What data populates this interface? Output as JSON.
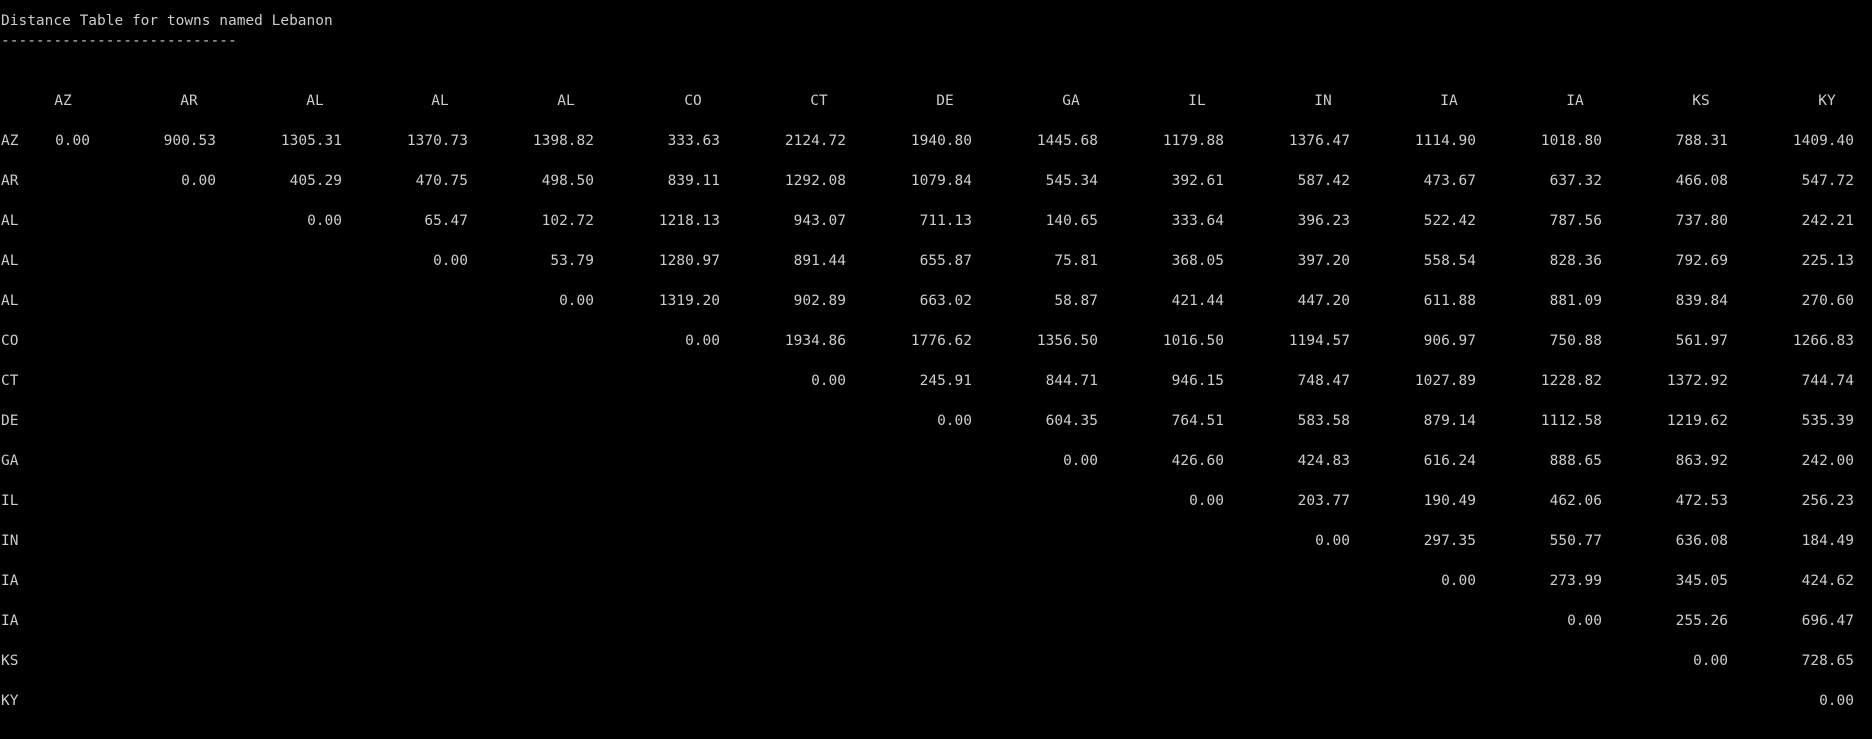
{
  "window": {
    "title": "Distance Table for towns named Lebanon",
    "underline": "---------------------------"
  },
  "table": {
    "columns": [
      "AZ",
      "AR",
      "AL",
      "AL",
      "AL",
      "CO",
      "CT",
      "DE",
      "GA",
      "IL",
      "IN",
      "IA",
      "IA",
      "KS",
      "KY"
    ],
    "rows": [
      {
        "label": "AZ",
        "values": [
          "0.00",
          "900.53",
          "1305.31",
          "1370.73",
          "1398.82",
          "333.63",
          "2124.72",
          "1940.80",
          "1445.68",
          "1179.88",
          "1376.47",
          "1114.90",
          "1018.80",
          "788.31",
          "1409.40"
        ]
      },
      {
        "label": "AR",
        "values": [
          "",
          "0.00",
          "405.29",
          "470.75",
          "498.50",
          "839.11",
          "1292.08",
          "1079.84",
          "545.34",
          "392.61",
          "587.42",
          "473.67",
          "637.32",
          "466.08",
          "547.72"
        ]
      },
      {
        "label": "AL",
        "values": [
          "",
          "",
          "0.00",
          "65.47",
          "102.72",
          "1218.13",
          "943.07",
          "711.13",
          "140.65",
          "333.64",
          "396.23",
          "522.42",
          "787.56",
          "737.80",
          "242.21"
        ]
      },
      {
        "label": "AL",
        "values": [
          "",
          "",
          "",
          "0.00",
          "53.79",
          "1280.97",
          "891.44",
          "655.87",
          "75.81",
          "368.05",
          "397.20",
          "558.54",
          "828.36",
          "792.69",
          "225.13"
        ]
      },
      {
        "label": "AL",
        "values": [
          "",
          "",
          "",
          "",
          "0.00",
          "1319.20",
          "902.89",
          "663.02",
          "58.87",
          "421.44",
          "447.20",
          "611.88",
          "881.09",
          "839.84",
          "270.60"
        ]
      },
      {
        "label": "CO",
        "values": [
          "",
          "",
          "",
          "",
          "",
          "0.00",
          "1934.86",
          "1776.62",
          "1356.50",
          "1016.50",
          "1194.57",
          "906.97",
          "750.88",
          "561.97",
          "1266.83"
        ]
      },
      {
        "label": "CT",
        "values": [
          "",
          "",
          "",
          "",
          "",
          "",
          "0.00",
          "245.91",
          "844.71",
          "946.15",
          "748.47",
          "1027.89",
          "1228.82",
          "1372.92",
          "744.74"
        ]
      },
      {
        "label": "DE",
        "values": [
          "",
          "",
          "",
          "",
          "",
          "",
          "",
          "0.00",
          "604.35",
          "764.51",
          "583.58",
          "879.14",
          "1112.58",
          "1219.62",
          "535.39"
        ]
      },
      {
        "label": "GA",
        "values": [
          "",
          "",
          "",
          "",
          "",
          "",
          "",
          "",
          "0.00",
          "426.60",
          "424.83",
          "616.24",
          "888.65",
          "863.92",
          "242.00"
        ]
      },
      {
        "label": "IL",
        "values": [
          "",
          "",
          "",
          "",
          "",
          "",
          "",
          "",
          "",
          "0.00",
          "203.77",
          "190.49",
          "462.06",
          "472.53",
          "256.23"
        ]
      },
      {
        "label": "IN",
        "values": [
          "",
          "",
          "",
          "",
          "",
          "",
          "",
          "",
          "",
          "",
          "0.00",
          "297.35",
          "550.77",
          "636.08",
          "184.49"
        ]
      },
      {
        "label": "IA",
        "values": [
          "",
          "",
          "",
          "",
          "",
          "",
          "",
          "",
          "",
          "",
          "",
          "0.00",
          "273.99",
          "345.05",
          "424.62"
        ]
      },
      {
        "label": "IA",
        "values": [
          "",
          "",
          "",
          "",
          "",
          "",
          "",
          "",
          "",
          "",
          "",
          "",
          "0.00",
          "255.26",
          "696.47"
        ]
      },
      {
        "label": "KS",
        "values": [
          "",
          "",
          "",
          "",
          "",
          "",
          "",
          "",
          "",
          "",
          "",
          "",
          "",
          "0.00",
          "728.65"
        ]
      },
      {
        "label": "KY",
        "values": [
          "",
          "",
          "",
          "",
          "",
          "",
          "",
          "",
          "",
          "",
          "",
          "",
          "",
          "",
          "0.00"
        ]
      }
    ]
  }
}
